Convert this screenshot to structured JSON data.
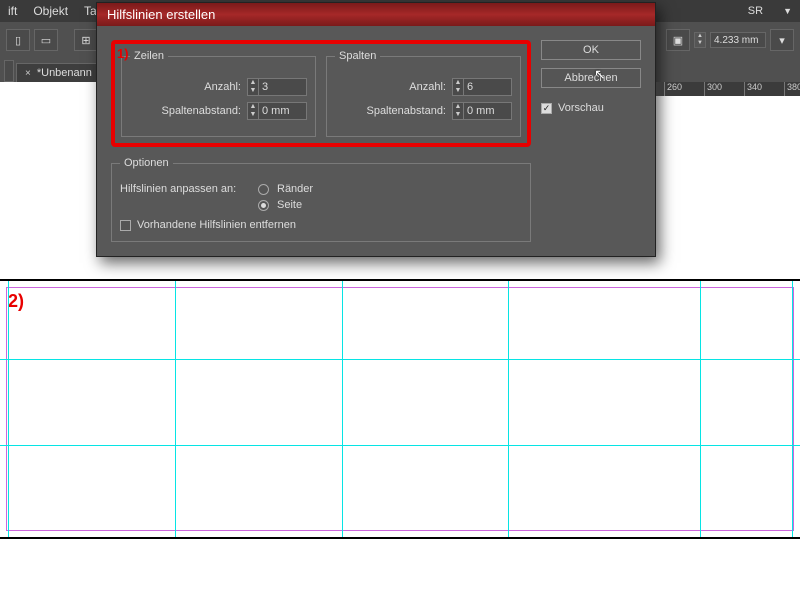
{
  "menubar": {
    "items": [
      "ift",
      "Objekt",
      "Ta"
    ],
    "right_label": "SR"
  },
  "toolbar": {
    "dim_value": "4.233 mm"
  },
  "doctab": {
    "label": "*Unbenann"
  },
  "ruler": {
    "ticks": [
      "260",
      "300",
      "340",
      "380"
    ]
  },
  "dialog": {
    "title": "Hilfslinien erstellen",
    "annotation": "1)",
    "rows_group": {
      "legend": "Zeilen",
      "count_label": "Anzahl:",
      "count_value": "3",
      "gap_label": "Spaltenabstand:",
      "gap_value": "0 mm"
    },
    "cols_group": {
      "legend": "Spalten",
      "count_label": "Anzahl:",
      "count_value": "6",
      "gap_label": "Spaltenabstand:",
      "gap_value": "0 mm"
    },
    "options": {
      "legend": "Optionen",
      "fit_label": "Hilfslinien anpassen an:",
      "radio_margins": "Ränder",
      "radio_page": "Seite",
      "remove_existing": "Vorhandene Hilfslinien entfernen"
    },
    "buttons": {
      "ok": "OK",
      "cancel": "Abbrechen"
    },
    "preview_label": "Vorschau"
  },
  "page": {
    "step_label": "2)"
  }
}
